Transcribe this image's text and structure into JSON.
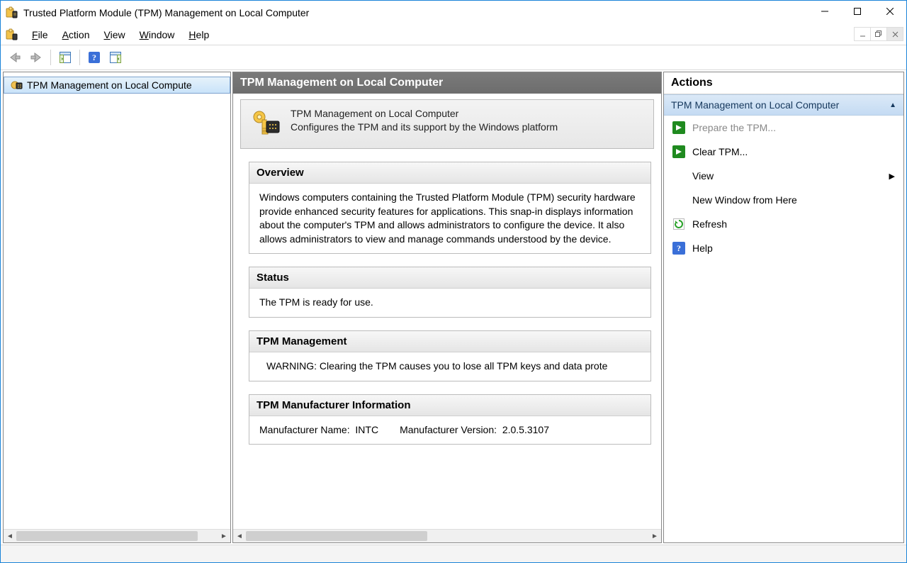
{
  "window": {
    "title": "Trusted Platform Module (TPM) Management on Local Computer"
  },
  "menubar": {
    "file": "File",
    "action": "Action",
    "view": "View",
    "window": "Window",
    "help": "Help"
  },
  "tree": {
    "root_label": "TPM Management on Local Compute"
  },
  "center": {
    "header": "TPM Management on Local Computer",
    "summary_line1": "TPM Management on Local Computer",
    "summary_line2": "Configures the TPM and its support by the Windows platform",
    "overview_hdr": "Overview",
    "overview_body": "Windows computers containing the Trusted Platform Module (TPM) security hardware provide enhanced security features for applications. This snap-in displays information about the computer's TPM and allows administrators to configure the device. It also allows administrators to view and manage commands understood by the device.",
    "status_hdr": "Status",
    "status_body": "The TPM is ready for use.",
    "mgmt_hdr": "TPM Management",
    "mgmt_body": "WARNING: Clearing the TPM causes you to lose all TPM keys and data prote",
    "manu_hdr": "TPM Manufacturer Information",
    "manu_name_label": "Manufacturer Name:",
    "manu_name_value": "INTC",
    "manu_ver_label": "Manufacturer Version:",
    "manu_ver_value": "2.0.5.3107"
  },
  "actions": {
    "panel_title": "Actions",
    "group_title": "TPM Management on Local Computer",
    "prepare": "Prepare the TPM...",
    "clear": "Clear TPM...",
    "view": "View",
    "new_window": "New Window from Here",
    "refresh": "Refresh",
    "help": "Help"
  }
}
